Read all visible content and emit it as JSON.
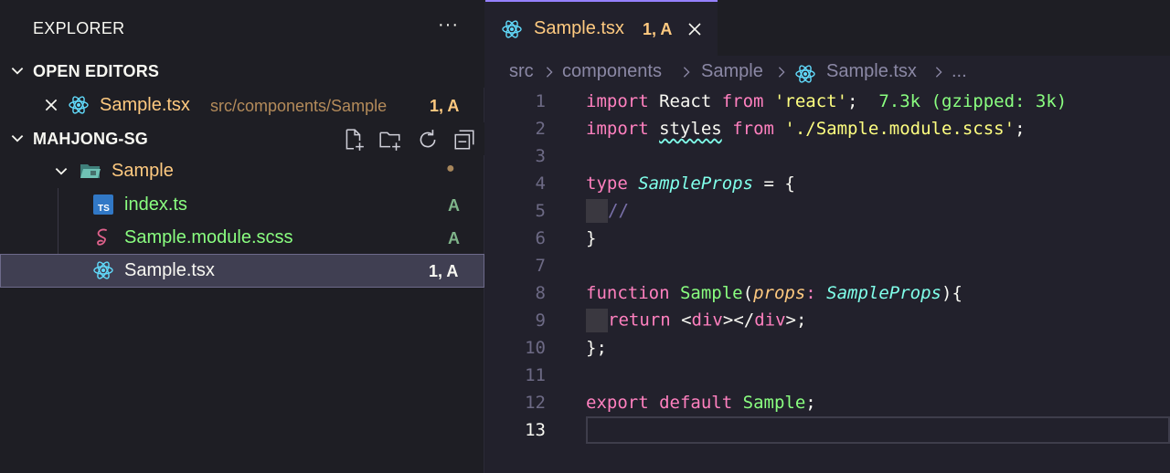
{
  "sidebar": {
    "title": "EXPLORER",
    "more_label": "···",
    "open_editors": {
      "label": "OPEN EDITORS",
      "items": [
        {
          "name": "Sample.tsx",
          "path": "src/components/Sample",
          "status": "1, A"
        }
      ]
    },
    "workspace": {
      "label": "MAHJONG-SG",
      "folder": {
        "name": "Sample",
        "status": "●"
      },
      "files": [
        {
          "name": "index.ts",
          "status": "A",
          "icon": "typescript-icon"
        },
        {
          "name": "Sample.module.scss",
          "status": "A",
          "icon": "sass-icon"
        },
        {
          "name": "Sample.tsx",
          "status": "1, A",
          "icon": "react-icon"
        }
      ]
    }
  },
  "editor": {
    "tab": {
      "name": "Sample.tsx",
      "status": "1, A"
    },
    "breadcrumb": [
      "src",
      "components",
      "Sample",
      "Sample.tsx",
      "..."
    ],
    "line_numbers": [
      "1",
      "2",
      "3",
      "4",
      "5",
      "6",
      "7",
      "8",
      "9",
      "10",
      "11",
      "12",
      "13"
    ],
    "code": {
      "l1": {
        "kw1": "import",
        "id": " React ",
        "kw2": "from",
        "sp": " ",
        "str": "'react'",
        "semi": ";",
        "hint": "  7.3k (gzipped: 3k)"
      },
      "l2": {
        "kw1": "import",
        "sp1": " ",
        "id": "styles",
        "sp2": " ",
        "kw2": "from",
        "sp3": " ",
        "str": "'./Sample.module.scss'",
        "semi": ";"
      },
      "l4": {
        "kw": "type",
        "sp": " ",
        "typ": "SampleProps",
        "rest": " = {"
      },
      "l5": {
        "com": "//"
      },
      "l6": {
        "text": "}"
      },
      "l8": {
        "kw": "function",
        "sp": " ",
        "fn": "Sample",
        "p1": "(",
        "param": "props",
        "colon": ": ",
        "typ": "SampleProps",
        "p2": "){"
      },
      "l9": {
        "kw": "return",
        "sp": " ",
        "lt1": "<",
        "tag1": "div",
        "mid": "></",
        "tag2": "div",
        "gt": ">;"
      },
      "l10": {
        "text": "};"
      },
      "l12": {
        "kw1": "export",
        "sp1": " ",
        "kw2": "default",
        "sp2": " ",
        "fn": "Sample",
        "semi": ";"
      }
    }
  },
  "colors": {
    "accent": "#9580ff",
    "modified_file": "#ffca80",
    "added_file": "#8aff80",
    "status_added": "#7fb48a"
  }
}
